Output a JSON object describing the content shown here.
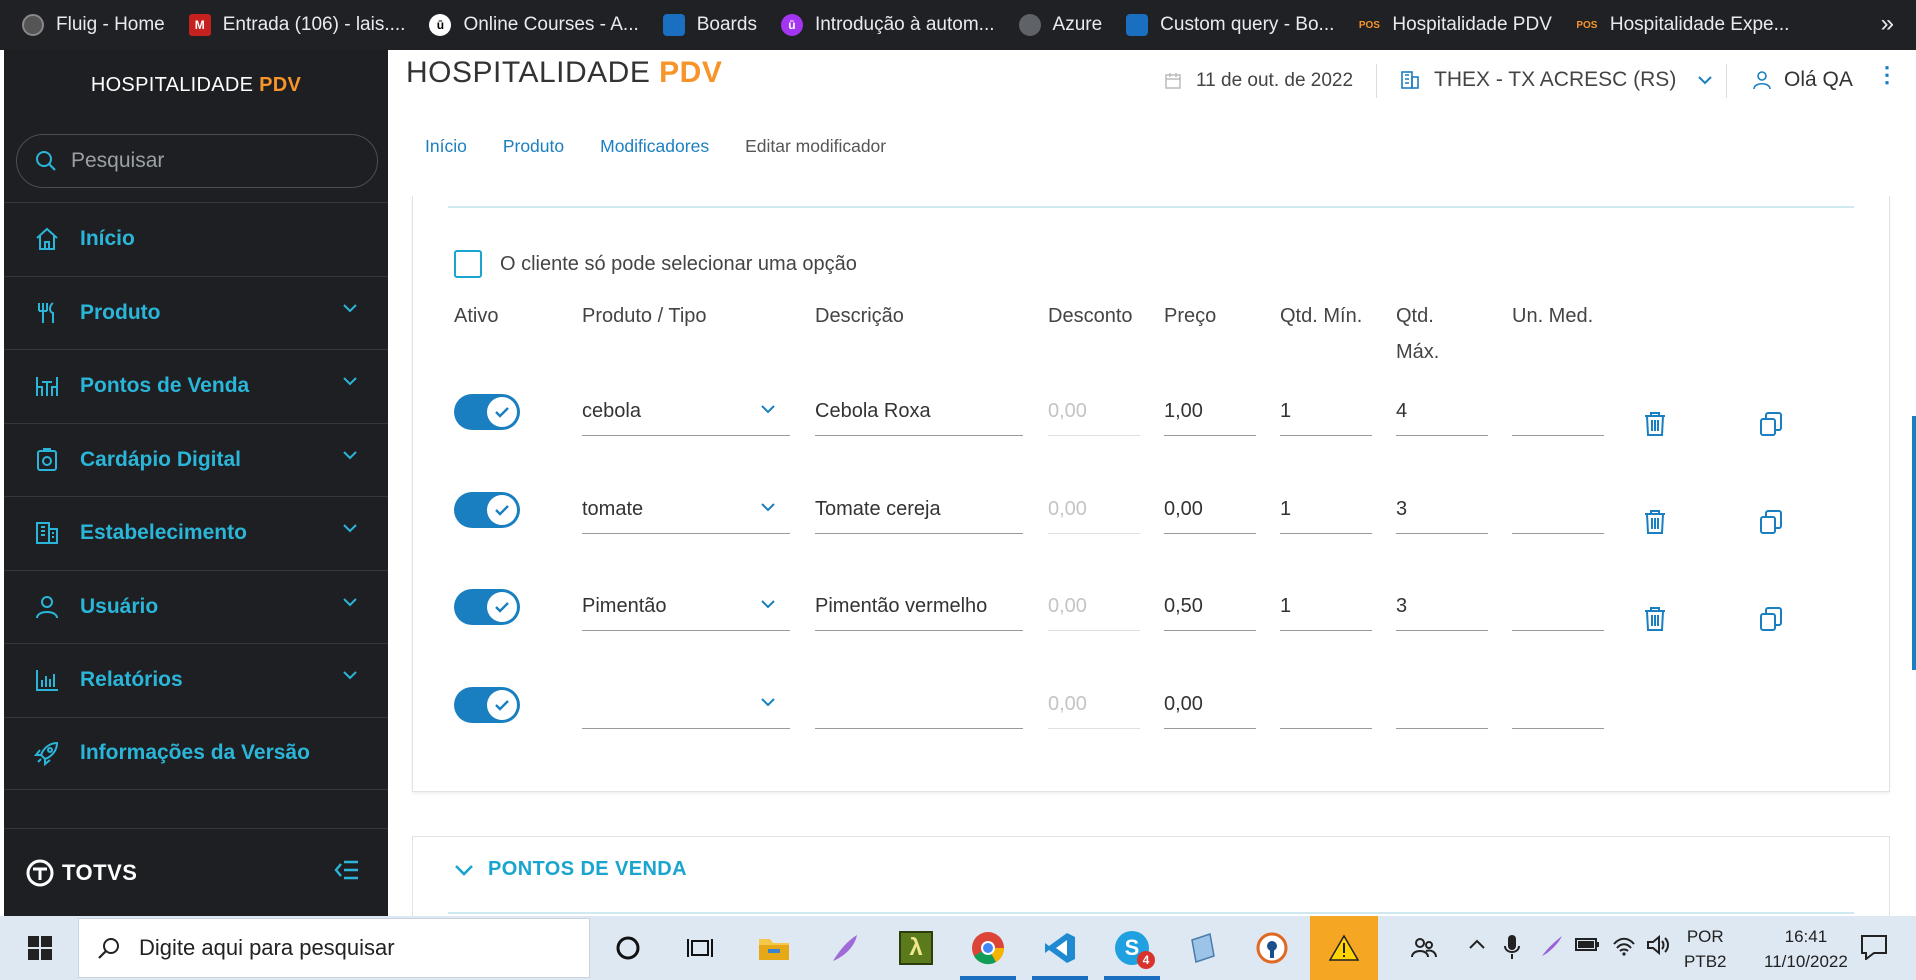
{
  "bookmarks": [
    {
      "label": "Fluig - Home",
      "icon": "fluig-icon",
      "color": "#555555",
      "glyph": ""
    },
    {
      "label": "Entrada (106) - lais....",
      "icon": "gmail-icon",
      "color": "#c5221f",
      "glyph": "M"
    },
    {
      "label": "Online Courses - A...",
      "icon": "udemy-icon",
      "color": "#ffffff",
      "glyph": "ū"
    },
    {
      "label": "Boards",
      "icon": "azure-boards-icon",
      "color": "#1a6fc1",
      "glyph": ""
    },
    {
      "label": "Introdução à autom...",
      "icon": "udemy-purple-icon",
      "color": "#a435f0",
      "glyph": "ū"
    },
    {
      "label": "Azure",
      "icon": "globe-icon",
      "color": "#5f6368",
      "glyph": ""
    },
    {
      "label": "Custom query - Bo...",
      "icon": "azure-boards-icon",
      "color": "#1a6fc1",
      "glyph": ""
    },
    {
      "label": "Hospitalidade PDV",
      "icon": "pos-icon",
      "color": "#f7942a",
      "glyph": "POS"
    },
    {
      "label": "Hospitalidade Expe...",
      "icon": "pos-icon",
      "color": "#f7942a",
      "glyph": "POS"
    }
  ],
  "sidebar": {
    "brand_main": "HOSPITALIDADE ",
    "brand_accent": "PDV",
    "search_placeholder": "Pesquisar",
    "items": [
      {
        "label": "Início",
        "icon": "home-icon",
        "has_children": false
      },
      {
        "label": "Produto",
        "icon": "cutlery-icon",
        "has_children": true
      },
      {
        "label": "Pontos de Venda",
        "icon": "table-chairs-icon",
        "has_children": true
      },
      {
        "label": "Cardápio Digital",
        "icon": "tablet-menu-icon",
        "has_children": true
      },
      {
        "label": "Estabelecimento",
        "icon": "building-icon",
        "has_children": true
      },
      {
        "label": "Usuário",
        "icon": "user-icon",
        "has_children": true
      },
      {
        "label": "Relatórios",
        "icon": "bar-chart-icon",
        "has_children": true
      },
      {
        "label": "Informações da Versão",
        "icon": "rocket-icon",
        "has_children": false
      }
    ],
    "footer_logo": "TOTVS"
  },
  "header": {
    "title_main": "HOSPITALIDADE ",
    "title_accent": "PDV",
    "date": "11 de out. de 2022",
    "store": "THEX - TX ACRESC (RS)",
    "user": "Olá QA",
    "kebab": "⋮"
  },
  "breadcrumb": [
    "Início",
    "Produto",
    "Modificadores",
    "Editar modificador"
  ],
  "form": {
    "single_option_label": "O cliente só pode selecionar uma opção",
    "single_option_checked": false,
    "columns": {
      "ativo": "Ativo",
      "produto": "Produto / Tipo",
      "descricao": "Descrição",
      "desconto": "Desconto",
      "preco": "Preço",
      "qtd_min": "Qtd. Mín.",
      "qtd_max": "Qtd. Máx.",
      "un_med": "Un. Med."
    },
    "rows": [
      {
        "active": true,
        "produto": "cebola",
        "descricao": "Cebola Roxa",
        "desconto": "0,00",
        "preco": "1,00",
        "qtd_min": "1",
        "qtd_max": "4",
        "un_med": ""
      },
      {
        "active": true,
        "produto": "tomate",
        "descricao": "Tomate cereja",
        "desconto": "0,00",
        "preco": "0,00",
        "qtd_min": "1",
        "qtd_max": "3",
        "un_med": ""
      },
      {
        "active": true,
        "produto": "Pimentão",
        "descricao": "Pimentão vermelho",
        "desconto": "0,00",
        "preco": "0,50",
        "qtd_min": "1",
        "qtd_max": "3",
        "un_med": ""
      },
      {
        "active": true,
        "produto": "",
        "descricao": "",
        "desconto": "0,00",
        "preco": "0,00",
        "qtd_min": "",
        "qtd_max": "",
        "un_med": ""
      }
    ]
  },
  "section2": {
    "title": "PONTOS DE VENDA"
  },
  "taskbar": {
    "search_placeholder": "Digite aqui para pesquisar",
    "lang_1": "POR",
    "lang_2": "PTB2",
    "time": "16:41",
    "date": "11/10/2022",
    "skype_badge": "4"
  },
  "colors": {
    "accent": "#f7942a",
    "primary": "#1a7fc1",
    "sidebar_text": "#2bb5d8",
    "sidebar_bg": "#1d1f22"
  }
}
